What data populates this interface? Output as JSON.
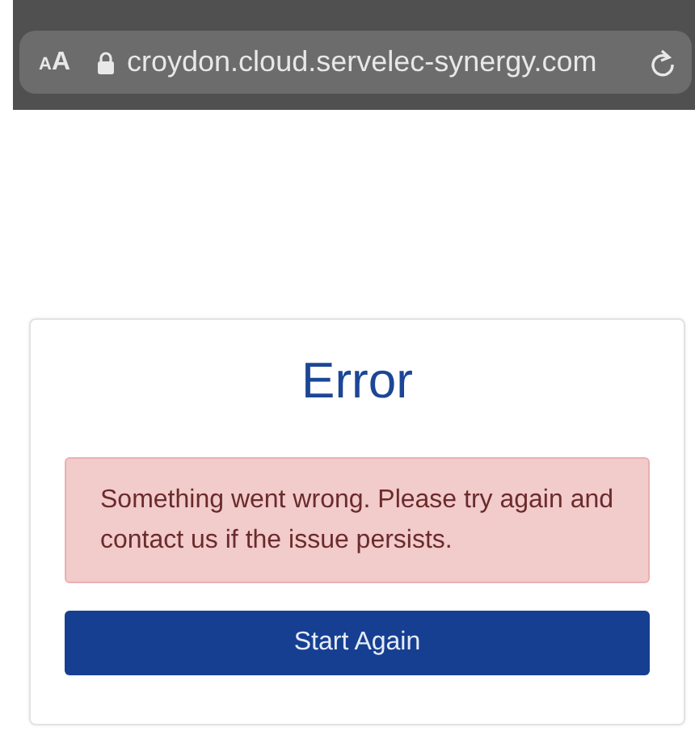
{
  "browser": {
    "text_size_button": "AA",
    "url": "croydon.cloud.servelec-synergy.com"
  },
  "error_card": {
    "title": "Error",
    "message": "Something went wrong. Please try again and contact us if the issue persists.",
    "button": "Start Again"
  }
}
